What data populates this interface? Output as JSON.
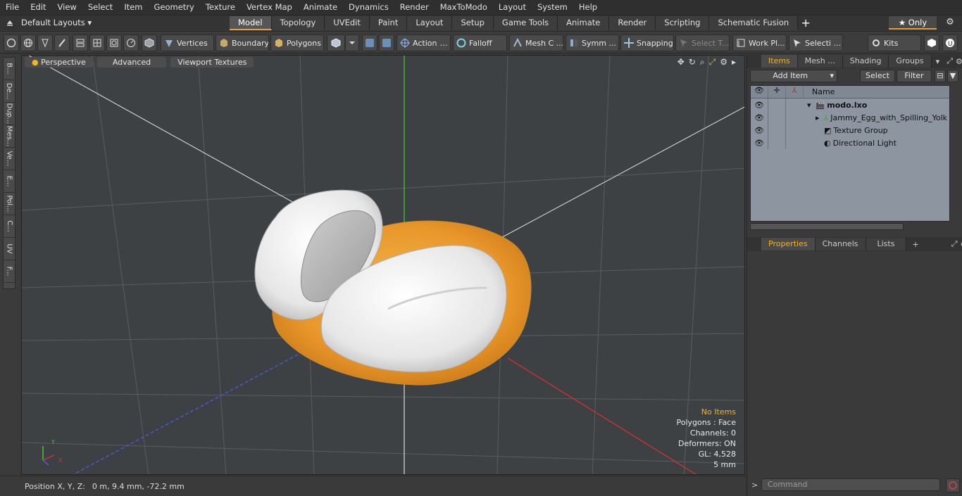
{
  "menu": [
    "File",
    "Edit",
    "View",
    "Select",
    "Item",
    "Geometry",
    "Texture",
    "Vertex Map",
    "Animate",
    "Dynamics",
    "Render",
    "MaxToModo",
    "Layout",
    "System",
    "Help"
  ],
  "layout_selector": {
    "label": "Default Layouts ▾"
  },
  "tabs": [
    {
      "label": "Model",
      "active": true
    },
    {
      "label": "Topology"
    },
    {
      "label": "UVEdit"
    },
    {
      "label": "Paint"
    },
    {
      "label": "Layout"
    },
    {
      "label": "Setup"
    },
    {
      "label": "Game Tools"
    },
    {
      "label": "Animate"
    },
    {
      "label": "Render"
    },
    {
      "label": "Scripting"
    },
    {
      "label": "Schematic Fusion"
    }
  ],
  "tab_add": "+",
  "only_button": "★  Only",
  "toolbar": {
    "vertices": "Vertices",
    "boundary": "Boundary",
    "polygons": "Polygons",
    "action": "Action",
    "falloff": "Falloff",
    "mesh_c": "Mesh C ...",
    "symm": "Symm ...",
    "snapping": "Snapping",
    "select_t": "Select T...",
    "work_pl": "Work Pl...",
    "selecti": "Selecti ...",
    "kits": "Kits"
  },
  "left_tabs": [
    "B...",
    "De...",
    "Dup...",
    "Mes...",
    "Ve...",
    "E...",
    "Pol...",
    "C...",
    "UV",
    "F..."
  ],
  "viewport": {
    "perspective": "Perspective",
    "advanced": "Advanced",
    "viewport_textures": "Viewport Textures",
    "stats": {
      "no_items": "No Items",
      "polygons": "Polygons : Face",
      "channels": "Channels: 0",
      "deformers": "Deformers: ON",
      "gl": "GL: 4,528",
      "unit": "5 mm"
    }
  },
  "status": {
    "label": "Position X, Y, Z:",
    "value": "0 m, 9.4 mm, -72.2 mm"
  },
  "items_panel": {
    "tabs": [
      "Items",
      "Mesh ...",
      "Shading",
      "Groups"
    ],
    "add_item": "Add Item",
    "select": "Select",
    "filter": "Filter",
    "name_header": "Name",
    "tree": [
      {
        "label": "modo.lxo",
        "bold": true
      },
      {
        "label": "Jammy_Egg_with_Spilling_Yolk"
      },
      {
        "label": "Texture Group"
      },
      {
        "label": "Directional Light"
      }
    ]
  },
  "props_panel": {
    "tabs": [
      "Properties",
      "Channels",
      "Lists"
    ],
    "add": "+"
  },
  "command": {
    "placeholder": "Command"
  },
  "colors": {
    "accent": "#e0a13a",
    "highlight": "#f0b428",
    "yolk": "#e89a2c",
    "egg_white": "#f2f2f2"
  }
}
